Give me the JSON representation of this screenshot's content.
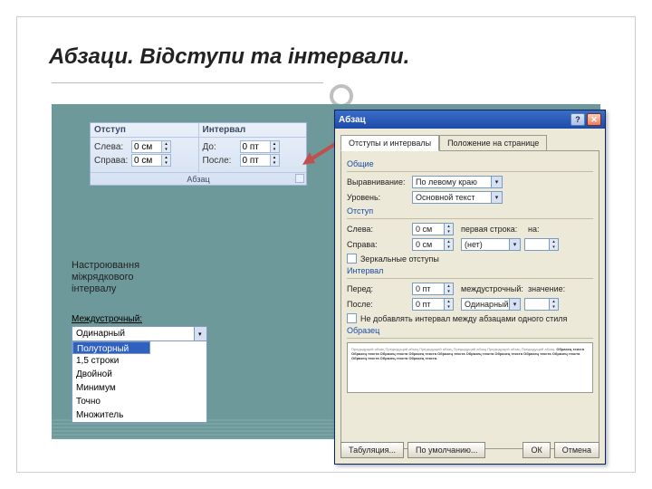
{
  "title": "Абзаци. Відступи та інтервали.",
  "ribbon": {
    "col1_header": "Отступ",
    "col2_header": "Интервал",
    "left_lbl": "Слева:",
    "left_val": "0 см",
    "right_lbl": "Справа:",
    "right_val": "0 см",
    "before_lbl": "До:",
    "before_val": "0 пт",
    "after_lbl": "После:",
    "after_val": "0 пт",
    "group_name": "Абзац"
  },
  "note": "Настроювання міжрядкового інтервалу",
  "combo": {
    "label": "Междустрочный:",
    "options": [
      "Одинарный",
      "Полуторный",
      "1,5 строки",
      "Двойной",
      "Минимум",
      "Точно",
      "Множитель"
    ],
    "selected_index": 1
  },
  "dialog": {
    "title": "Абзац",
    "tab1": "Отступы и интервалы",
    "tab2": "Положение на странице",
    "sec_general": "Общие",
    "align_lbl": "Выравнивание:",
    "align_val": "По левому краю",
    "level_lbl": "Уровень:",
    "level_val": "Основной текст",
    "sec_indent": "Отступ",
    "ileft_lbl": "Слева:",
    "ileft_val": "0 см",
    "iright_lbl": "Справа:",
    "iright_val": "0 см",
    "first_lbl": "первая строка:",
    "first_val": "(нет)",
    "on_lbl": "на:",
    "on_val": "",
    "mirror_cb": "Зеркальные отступы",
    "sec_spacing": "Интервал",
    "sbefore_lbl": "Перед:",
    "sbefore_val": "0 пт",
    "safter_lbl": "После:",
    "safter_val": "0 пт",
    "line_lbl": "междустрочный:",
    "line_val": "Одинарный",
    "val_lbl": "значение:",
    "val_val": "",
    "noadd_cb": "Не добавлять интервал между абзацами одного стиля",
    "sec_preview": "Образец",
    "btn_tabs": "Табуляция...",
    "btn_default": "По умолчанию...",
    "btn_ok": "ОК",
    "btn_cancel": "Отмена"
  }
}
